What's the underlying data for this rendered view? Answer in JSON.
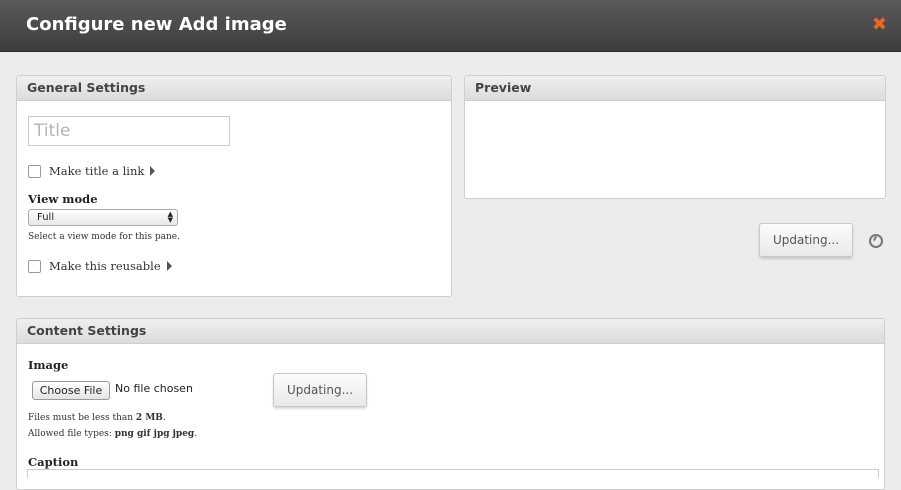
{
  "dialog": {
    "title": "Configure new Add image",
    "close_symbol": "✖"
  },
  "general": {
    "heading": "General Settings",
    "title_placeholder": "Title",
    "make_title_link_label": "Make title a link",
    "view_mode_label": "View mode",
    "view_mode_value": "Full",
    "view_mode_desc": "Select a view mode for this pane.",
    "make_reusable_label": "Make this reusable"
  },
  "preview": {
    "heading": "Preview",
    "update_button": "Updating..."
  },
  "content": {
    "heading": "Content Settings",
    "image_label": "Image",
    "choose_file_button": "Choose File",
    "no_file_text": "No file chosen",
    "upload_button": "Updating...",
    "size_prefix": "Files must be less than ",
    "size_value": "2 MB",
    "size_suffix": ".",
    "types_prefix": "Allowed file types: ",
    "types_value": "png gif jpg jpeg",
    "types_suffix": ".",
    "caption_label": "Caption"
  }
}
